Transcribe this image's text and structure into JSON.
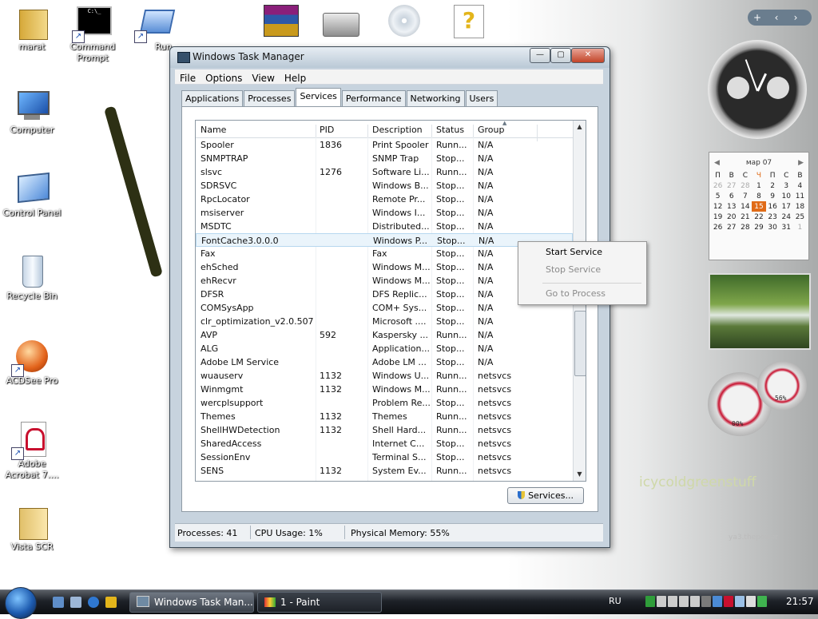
{
  "desktop": {
    "icons": [
      {
        "label": "marat",
        "icon": "folder-icon"
      },
      {
        "label": "Command Prompt",
        "icon": "console-icon"
      },
      {
        "label": "Run",
        "icon": "run-icon"
      },
      {
        "label": "Computer",
        "icon": "computer-icon"
      },
      {
        "label": "Control Panel",
        "icon": "control-panel-icon"
      },
      {
        "label": "Recycle Bin",
        "icon": "recycle-bin-icon"
      },
      {
        "label": "ACDSee Pro",
        "icon": "acdsee-icon"
      },
      {
        "label": "Adobe Acrobat 7....",
        "icon": "acrobat-icon"
      },
      {
        "label": "Vista SCR",
        "icon": "folder-icon"
      }
    ]
  },
  "window": {
    "title": "Windows Task Manager",
    "menu": [
      "File",
      "Options",
      "View",
      "Help"
    ],
    "tabs": [
      "Applications",
      "Processes",
      "Services",
      "Performance",
      "Networking",
      "Users"
    ],
    "active_tab": "Services",
    "columns": [
      "Name",
      "PID",
      "Description",
      "Status",
      "Group"
    ],
    "rows": [
      {
        "name": "Spooler",
        "pid": "1836",
        "desc": "Print Spooler",
        "status": "Runn...",
        "group": "N/A"
      },
      {
        "name": "SNMPTRAP",
        "pid": "",
        "desc": "SNMP Trap",
        "status": "Stop...",
        "group": "N/A"
      },
      {
        "name": "slsvc",
        "pid": "1276",
        "desc": "Software Li...",
        "status": "Runn...",
        "group": "N/A"
      },
      {
        "name": "SDRSVC",
        "pid": "",
        "desc": "Windows B...",
        "status": "Stop...",
        "group": "N/A"
      },
      {
        "name": "RpcLocator",
        "pid": "",
        "desc": "Remote Pr...",
        "status": "Stop...",
        "group": "N/A"
      },
      {
        "name": "msiserver",
        "pid": "",
        "desc": "Windows I...",
        "status": "Stop...",
        "group": "N/A"
      },
      {
        "name": "MSDTC",
        "pid": "",
        "desc": "Distributed...",
        "status": "Stop...",
        "group": "N/A"
      },
      {
        "name": "FontCache3.0.0.0",
        "pid": "",
        "desc": "Windows P...",
        "status": "Stop...",
        "group": "N/A"
      },
      {
        "name": "Fax",
        "pid": "",
        "desc": "Fax",
        "status": "Stop...",
        "group": "N/A"
      },
      {
        "name": "ehSched",
        "pid": "",
        "desc": "Windows M...",
        "status": "Stop...",
        "group": "N/A"
      },
      {
        "name": "ehRecvr",
        "pid": "",
        "desc": "Windows M...",
        "status": "Stop...",
        "group": "N/A"
      },
      {
        "name": "DFSR",
        "pid": "",
        "desc": "DFS Replic...",
        "status": "Stop...",
        "group": "N/A"
      },
      {
        "name": "COMSysApp",
        "pid": "",
        "desc": "COM+ Sys...",
        "status": "Stop...",
        "group": "N/A"
      },
      {
        "name": "clr_optimization_v2.0.507...",
        "pid": "",
        "desc": "Microsoft ....",
        "status": "Stop...",
        "group": "N/A"
      },
      {
        "name": "AVP",
        "pid": "592",
        "desc": "Kaspersky ...",
        "status": "Runn...",
        "group": "N/A"
      },
      {
        "name": "ALG",
        "pid": "",
        "desc": "Application...",
        "status": "Stop...",
        "group": "N/A"
      },
      {
        "name": "Adobe LM Service",
        "pid": "",
        "desc": "Adobe LM ...",
        "status": "Stop...",
        "group": "N/A"
      },
      {
        "name": "wuauserv",
        "pid": "1132",
        "desc": "Windows U...",
        "status": "Runn...",
        "group": "netsvcs"
      },
      {
        "name": "Winmgmt",
        "pid": "1132",
        "desc": "Windows M...",
        "status": "Runn...",
        "group": "netsvcs"
      },
      {
        "name": "wercplsupport",
        "pid": "",
        "desc": "Problem Re...",
        "status": "Stop...",
        "group": "netsvcs"
      },
      {
        "name": "Themes",
        "pid": "1132",
        "desc": "Themes",
        "status": "Runn...",
        "group": "netsvcs"
      },
      {
        "name": "ShellHWDetection",
        "pid": "1132",
        "desc": "Shell Hard...",
        "status": "Runn...",
        "group": "netsvcs"
      },
      {
        "name": "SharedAccess",
        "pid": "",
        "desc": "Internet C...",
        "status": "Stop...",
        "group": "netsvcs"
      },
      {
        "name": "SessionEnv",
        "pid": "",
        "desc": "Terminal S...",
        "status": "Stop...",
        "group": "netsvcs"
      },
      {
        "name": "SENS",
        "pid": "1132",
        "desc": "System Ev...",
        "status": "Runn...",
        "group": "netsvcs"
      }
    ],
    "selected_row": "FontCache3.0.0.0",
    "services_button": "Services...",
    "status": {
      "processes": "Processes: 41",
      "cpu": "CPU Usage: 1%",
      "memory": "Physical Memory: 55%"
    }
  },
  "context_menu": {
    "items": [
      {
        "label": "Start Service",
        "enabled": true
      },
      {
        "label": "Stop Service",
        "enabled": false
      },
      {
        "label": "Go to Process",
        "enabled": false
      }
    ]
  },
  "sidebar": {
    "calendar_month": "мар 07",
    "calendar_days_header": [
      "П",
      "В",
      "С",
      "Ч",
      "П",
      "С",
      "В"
    ],
    "calendar_weeks": [
      [
        "26",
        "27",
        "28",
        "1",
        "2",
        "3",
        "4"
      ],
      [
        "5",
        "6",
        "7",
        "8",
        "9",
        "10",
        "11"
      ],
      [
        "12",
        "13",
        "14",
        "15",
        "16",
        "17",
        "18"
      ],
      [
        "19",
        "20",
        "21",
        "22",
        "23",
        "24",
        "25"
      ],
      [
        "26",
        "27",
        "28",
        "29",
        "30",
        "31",
        "1"
      ]
    ],
    "calendar_today": "15",
    "gauge_cpu": "00%",
    "gauge_mem": "56%",
    "brand": "icycoldgreenstuff",
    "brand_sub": "ya3.thepower"
  },
  "taskbar": {
    "tasks": [
      {
        "label": "Windows Task Man...",
        "active": true
      },
      {
        "label": "1 - Paint",
        "active": false
      }
    ],
    "language": "RU",
    "time": "21:57"
  },
  "colors": {
    "accent": "#2f6fb5",
    "selection_bg": "#eaf4fb",
    "today": "#e06b17"
  }
}
